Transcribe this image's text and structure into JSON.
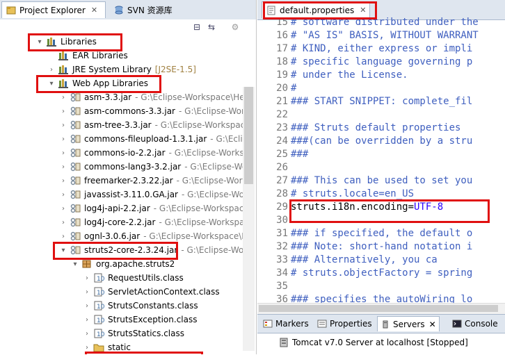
{
  "project_explorer": {
    "tabs": [
      {
        "label": "Project Explorer",
        "close": "✕"
      },
      {
        "label": "SVN 资源库"
      }
    ],
    "tree": [
      {
        "level": 3,
        "twisty": "▾",
        "icon": "library-icon",
        "label": "Libraries",
        "path": ""
      },
      {
        "level": 4,
        "twisty": "",
        "icon": "library-icon",
        "label": "EAR Libraries",
        "path": ""
      },
      {
        "level": 4,
        "twisty": "›",
        "icon": "library-icon",
        "label": "JRE System Library",
        "path": "[J2SE-1.5]"
      },
      {
        "level": 4,
        "twisty": "▾",
        "icon": "library-icon",
        "label": "Web App Libraries",
        "path": ""
      },
      {
        "level": 5,
        "twisty": "›",
        "icon": "jar-icon",
        "label": "asm-3.3.jar",
        "path": "- G:\\Eclipse-Workspace\\He"
      },
      {
        "level": 5,
        "twisty": "›",
        "icon": "jar-icon",
        "label": "asm-commons-3.3.jar",
        "path": "- G:\\Eclipse-Wor"
      },
      {
        "level": 5,
        "twisty": "›",
        "icon": "jar-icon",
        "label": "asm-tree-3.3.jar",
        "path": "- G:\\Eclipse-Workspac"
      },
      {
        "level": 5,
        "twisty": "›",
        "icon": "jar-icon",
        "label": "commons-fileupload-1.3.1.jar",
        "path": "- G:\\Eclip"
      },
      {
        "level": 5,
        "twisty": "›",
        "icon": "jar-icon",
        "label": "commons-io-2.2.jar",
        "path": "- G:\\Eclipse-Works"
      },
      {
        "level": 5,
        "twisty": "›",
        "icon": "jar-icon",
        "label": "commons-lang3-3.2.jar",
        "path": "- G:\\Eclipse-Wo"
      },
      {
        "level": 5,
        "twisty": "›",
        "icon": "jar-icon",
        "label": "freemarker-2.3.22.jar",
        "path": "- G:\\Eclipse-Worl"
      },
      {
        "level": 5,
        "twisty": "›",
        "icon": "jar-icon",
        "label": "javassist-3.11.0.GA.jar",
        "path": "- G:\\Eclipse-Wor"
      },
      {
        "level": 5,
        "twisty": "›",
        "icon": "jar-icon",
        "label": "log4j-api-2.2.jar",
        "path": "- G:\\Eclipse-Workspac"
      },
      {
        "level": 5,
        "twisty": "›",
        "icon": "jar-icon",
        "label": "log4j-core-2.2.jar",
        "path": "- G:\\Eclipse-Workspa"
      },
      {
        "level": 5,
        "twisty": "›",
        "icon": "jar-icon",
        "label": "ognl-3.0.6.jar",
        "path": "- G:\\Eclipse-Workspace\\H"
      },
      {
        "level": 5,
        "twisty": "▾",
        "icon": "jar-icon",
        "label": "struts2-core-2.3.24.jar",
        "path": "- G:\\Eclipse-Wor"
      },
      {
        "level": 6,
        "twisty": "▾",
        "icon": "package-icon",
        "label": "org.apache.struts2",
        "path": ""
      },
      {
        "level": 7,
        "twisty": "›",
        "icon": "class-file-icon",
        "label": "RequestUtils.class",
        "path": ""
      },
      {
        "level": 7,
        "twisty": "›",
        "icon": "class-file-icon",
        "label": "ServletActionContext.class",
        "path": ""
      },
      {
        "level": 7,
        "twisty": "›",
        "icon": "class-file-icon",
        "label": "StrutsConstants.class",
        "path": ""
      },
      {
        "level": 7,
        "twisty": "›",
        "icon": "class-file-icon",
        "label": "StrutsException.class",
        "path": ""
      },
      {
        "level": 7,
        "twisty": "›",
        "icon": "class-file-icon",
        "label": "StrutsStatics.class",
        "path": ""
      },
      {
        "level": 7,
        "twisty": "›",
        "icon": "folder-icon",
        "label": "static",
        "path": ""
      }
    ]
  },
  "editor": {
    "tab_label": "default.properties",
    "tab_close": "✕",
    "lines": [
      {
        "num": "15",
        "text": "# software distributed under the"
      },
      {
        "num": "16",
        "text": "# \"AS IS\" BASIS, WITHOUT WARRANT"
      },
      {
        "num": "17",
        "text": "# KIND, either express or impli"
      },
      {
        "num": "18",
        "text": "# specific language governing p"
      },
      {
        "num": "19",
        "text": "# under the License."
      },
      {
        "num": "20",
        "text": "#"
      },
      {
        "num": "21",
        "text": "### START SNIPPET: complete_fil"
      },
      {
        "num": "22",
        "text": ""
      },
      {
        "num": "23",
        "text": "### Struts default properties"
      },
      {
        "num": "24",
        "text": "###(can be overridden by a stru"
      },
      {
        "num": "25",
        "text": "###"
      },
      {
        "num": "26",
        "text": ""
      },
      {
        "num": "27",
        "text": "### This can be used to set you"
      },
      {
        "num": "28",
        "text": "# struts.locale=en_US"
      },
      {
        "num": "29",
        "key": "struts.i18n.encoding",
        "eq": "=",
        "val": "UTF-8"
      },
      {
        "num": "30",
        "text": ""
      },
      {
        "num": "31",
        "text": "### if specified, the default o"
      },
      {
        "num": "32",
        "text": "### Note: short-hand notation i"
      },
      {
        "num": "33",
        "text": "###       Alternatively, you ca"
      },
      {
        "num": "34",
        "text": "# struts.objectFactory = spring"
      },
      {
        "num": "35",
        "text": ""
      },
      {
        "num": "36",
        "text": "### specifies the autoWiring lo"
      }
    ]
  },
  "bottom": {
    "tabs": [
      {
        "label": "Markers"
      },
      {
        "label": "Properties"
      },
      {
        "label": "Servers",
        "close": "✕"
      },
      {
        "label": "Console"
      }
    ],
    "server_entry": "Tomcat v7.0 Server at localhost  [Stopped]"
  },
  "colors": {
    "highlight": "#e01010",
    "comment": "#3f5fbf",
    "string_value": "#2a00ff",
    "path_grey": "#7a7a7a"
  }
}
